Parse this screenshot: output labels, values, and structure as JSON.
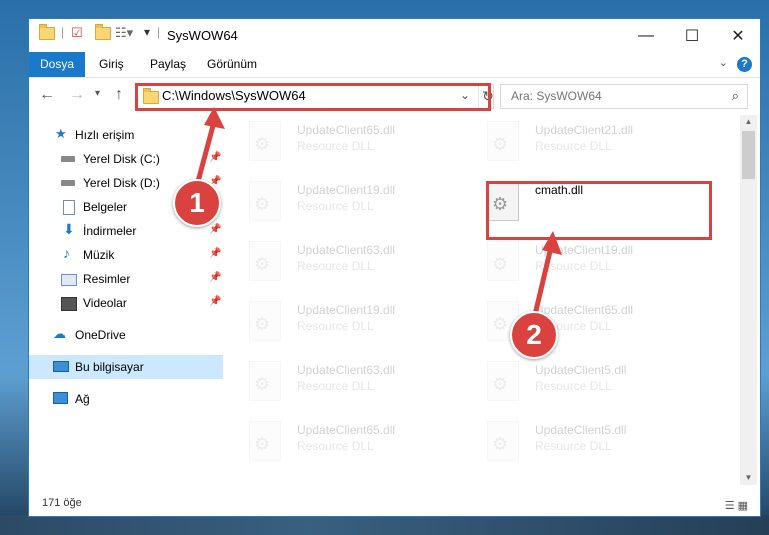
{
  "window": {
    "title": "SysWOW64",
    "minimize": "—",
    "maximize": "☐",
    "close": "✕"
  },
  "ribbon": {
    "tabs": [
      {
        "label": "Dosya",
        "active": true
      },
      {
        "label": "Giriş",
        "active": false
      },
      {
        "label": "Paylaş",
        "active": false
      },
      {
        "label": "Görünüm",
        "active": false
      }
    ],
    "help": "?"
  },
  "address_bar": {
    "path": "C:\\Windows\\SysWOW64",
    "search_placeholder": "Ara: SysWOW64"
  },
  "sidebar": {
    "items": [
      {
        "label": "Hızlı erişim",
        "icon": "star-icon"
      },
      {
        "label": "Yerel Disk (C:)",
        "icon": "drive-icon",
        "pinned": true
      },
      {
        "label": "Yerel Disk (D:)",
        "icon": "drive-icon",
        "pinned": true
      },
      {
        "label": "Belgeler",
        "icon": "document-icon",
        "pinned": true
      },
      {
        "label": "İndirmeler",
        "icon": "download-icon",
        "pinned": true
      },
      {
        "label": "Müzik",
        "icon": "music-icon",
        "pinned": true
      },
      {
        "label": "Resimler",
        "icon": "pictures-icon",
        "pinned": true
      },
      {
        "label": "Videolar",
        "icon": "video-icon",
        "pinned": true
      },
      {
        "label": "OneDrive",
        "icon": "cloud-icon"
      },
      {
        "label": "Bu bilgisayar",
        "icon": "computer-icon",
        "selected": true
      },
      {
        "label": "Ağ",
        "icon": "network-icon"
      }
    ]
  },
  "files": [
    {
      "name": "UpdateClient65.dll",
      "desc": "Resource DLL",
      "faded": true
    },
    {
      "name": "UpdateClient21.dll",
      "desc": "Resource DLL",
      "faded": true
    },
    {
      "name": "UpdateClient19.dll",
      "desc": "Resource DLL",
      "faded": true
    },
    {
      "name": "cmath.dll",
      "desc": "",
      "faded": false
    },
    {
      "name": "UpdateClient63.dll",
      "desc": "Resource DLL",
      "faded": true
    },
    {
      "name": "UpdateClient19.dll",
      "desc": "Resource DLL",
      "faded": true
    },
    {
      "name": "UpdateClient19.dll",
      "desc": "Resource DLL",
      "faded": true
    },
    {
      "name": "UpdateClient65.dll",
      "desc": "Resource DLL",
      "faded": true
    },
    {
      "name": "UpdateClient63.dll",
      "desc": "Resource DLL",
      "faded": true
    },
    {
      "name": "UpdateClient5.dll",
      "desc": "Resource DLL",
      "faded": true
    },
    {
      "name": "UpdateClient65.dll",
      "desc": "Resource DLL",
      "faded": true
    },
    {
      "name": "UpdateClient5.dll",
      "desc": "Resource DLL",
      "faded": true
    }
  ],
  "status": {
    "item_count": "171 öğe"
  },
  "annotations": {
    "step1": "1",
    "step2": "2",
    "color": "#d9423f"
  }
}
